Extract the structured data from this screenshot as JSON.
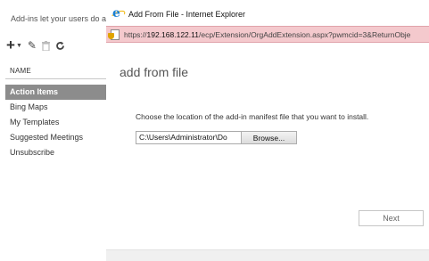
{
  "background_page": {
    "description": "Add-ins let your users do a",
    "toolbar": {
      "add_icon": "plus-icon",
      "dropdown_icon": "chevron-down-icon",
      "edit_icon": "pencil-icon",
      "delete_icon": "trash-icon",
      "refresh_icon": "refresh-icon"
    },
    "column_header": "NAME",
    "items": [
      {
        "label": "Action Items",
        "selected": true
      },
      {
        "label": "Bing Maps",
        "selected": false
      },
      {
        "label": "My Templates",
        "selected": false
      },
      {
        "label": "Suggested Meetings",
        "selected": false
      },
      {
        "label": "Unsubscribe",
        "selected": false
      }
    ]
  },
  "popup": {
    "window_title": "Add From File - Internet Explorer",
    "address": {
      "prefix": "https://",
      "host": "192.168.122.11",
      "path": "/ecp/Extension/OrgAddExtension.aspx?pwmcid=3&ReturnObje"
    },
    "heading": "add from file",
    "instruction": "Choose the location of the add-in manifest file that you want to install.",
    "file_input_value": "C:\\Users\\Administrator\\Do",
    "browse_label": "Browse...",
    "next_label": "Next"
  },
  "colors": {
    "address_bar_bg": "#f4c9cd",
    "selected_item_bg": "#8c8c8c"
  }
}
